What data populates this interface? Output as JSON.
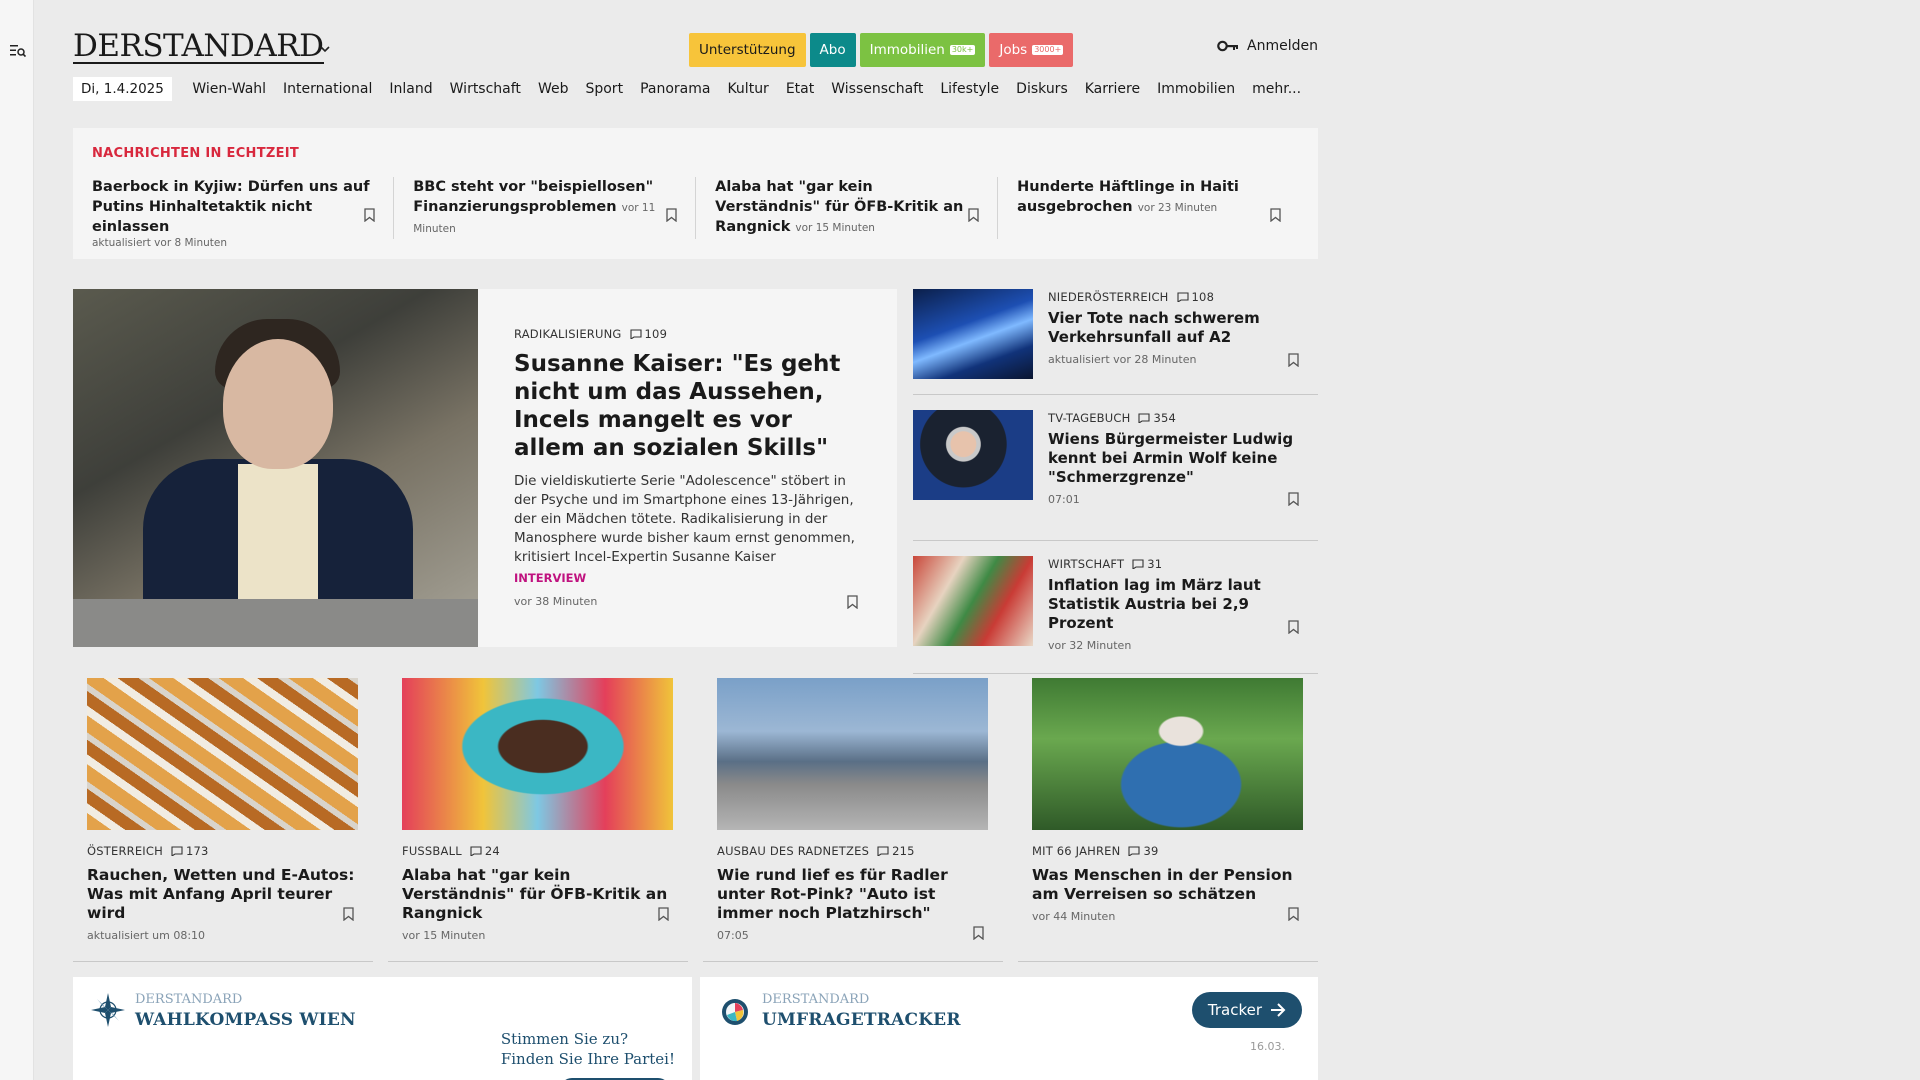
{
  "header": {
    "logo": "DERSTANDARD",
    "pills": {
      "support": "Unterstützung",
      "abo": "Abo",
      "immobilien": "Immobilien",
      "immobilien_tag": "30k+",
      "jobs": "Jobs",
      "jobs_tag": "3000+"
    },
    "login": "Anmelden"
  },
  "nav": {
    "date": "Di, 1.4.2025",
    "items": [
      "Wien-Wahl",
      "International",
      "Inland",
      "Wirtschaft",
      "Web",
      "Sport",
      "Panorama",
      "Kultur",
      "Etat",
      "Wissenschaft",
      "Lifestyle",
      "Diskurs",
      "Karriere",
      "Immobilien",
      "mehr..."
    ]
  },
  "live": {
    "title": "NACHRICHTEN IN ECHTZEIT",
    "items": [
      {
        "headline": "Baerbock in Kyjiw: Dürfen uns auf Putins Hinhaltetaktik nicht einlassen",
        "meta": "aktualisiert vor 8 Minuten"
      },
      {
        "headline": "BBC steht vor \"beispiellosen\" Finanzierungsproblemen",
        "meta": "vor 11 Minuten"
      },
      {
        "headline": "Alaba hat \"gar kein Verständnis\" für ÖFB-Kritik an Rangnick",
        "meta": "vor 15 Minuten"
      },
      {
        "headline": "Hunderte Häftlinge in Haiti ausgebrochen",
        "meta": "vor 23 Minuten"
      }
    ]
  },
  "lead": {
    "kicker": "RADIKALISIERUNG",
    "comments": "109",
    "title": "Susanne Kaiser: \"Es geht nicht um das Aussehen, Incels mangelt es vor allem an sozialen Skills\"",
    "teaser": "Die vieldiskutierte Serie \"Adolescence\" stöbert in der Psyche und im Smartphone eines 13-Jährigen, der ein Mädchen tötete. Radikalisierung in der Manosphere wurde bisher kaum ernst genommen, kritisiert Incel-Expertin Susanne Kaiser",
    "label": "INTERVIEW",
    "meta": "vor 38 Minuten"
  },
  "side": [
    {
      "kicker": "NIEDERÖSTERREICH",
      "comments": "108",
      "headline": "Vier Tote nach schwerem Verkehrsunfall auf A2",
      "meta": "aktualisiert vor 28 Minuten"
    },
    {
      "kicker": "TV-TAGEBUCH",
      "comments": "354",
      "headline": "Wiens Bürgermeister Ludwig kennt bei Armin Wolf keine \"Schmerzgrenze\"",
      "meta": "07:01"
    },
    {
      "kicker": "WIRTSCHAFT",
      "comments": "31",
      "headline": "Inflation lag im März laut Statistik Austria bei 2,9 Prozent",
      "meta": "vor 32 Minuten"
    }
  ],
  "cards": [
    {
      "kicker": "ÖSTERREICH",
      "comments": "173",
      "headline": "Rauchen, Wetten und E-Autos: Was mit Anfang April teurer wird",
      "meta": "aktualisiert um 08:10"
    },
    {
      "kicker": "FUSSBALL",
      "comments": "24",
      "headline": "Alaba hat \"gar kein Verständnis\" für ÖFB-Kritik an Rangnick",
      "meta": "vor 15 Minuten"
    },
    {
      "kicker": "AUSBAU DES RADNETZES",
      "comments": "215",
      "headline": "Wie rund lief es für Radler unter Rot-Pink? \"Auto ist immer noch Platzhirsch\"",
      "meta": "07:05"
    },
    {
      "kicker": "MIT 66 JAHREN",
      "comments": "39",
      "headline": "Was Menschen in der Pension am Verreisen so schätzen",
      "meta": "vor 44 Minuten"
    }
  ],
  "modules": {
    "wahlkompass": {
      "brand": "DERSTANDARD",
      "name": "WAHLKOMPASS WIEN",
      "cta_line1": "Stimmen Sie zu?",
      "cta_line2": "Finden Sie Ihre Partei!"
    },
    "umfragetracker": {
      "brand": "DERSTANDARD",
      "name": "UMFRAGETRACKER",
      "button": "Tracker",
      "date": "16.03."
    }
  },
  "colors": {
    "live_title": "#d8283d",
    "interview_label": "#c0127f",
    "module_accent": "#1e4f6e"
  }
}
